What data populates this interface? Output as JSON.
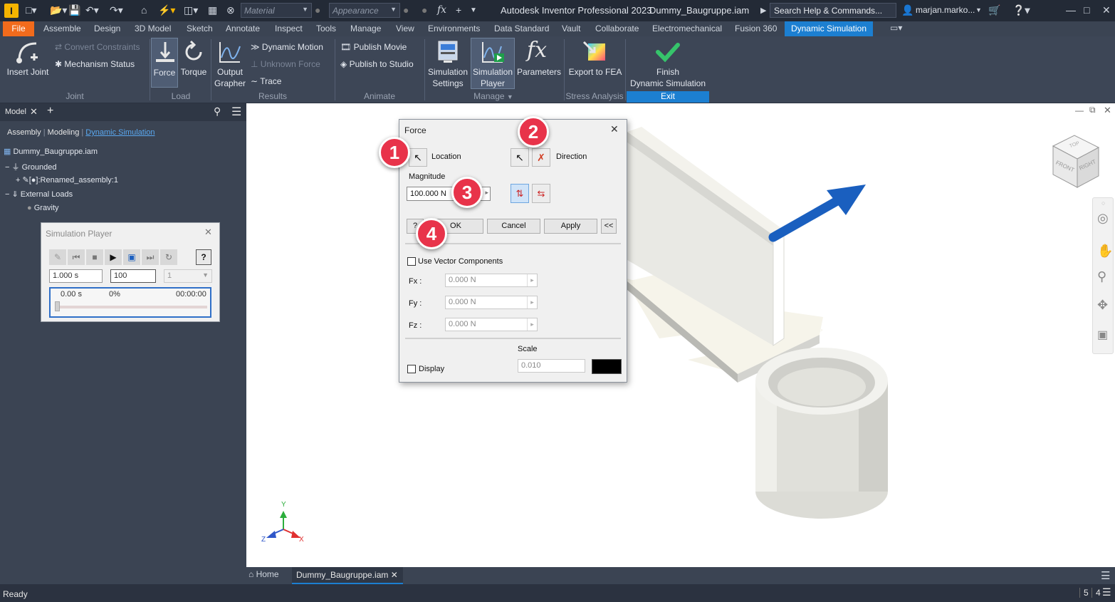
{
  "app": {
    "title": "Autodesk Inventor Professional 2023",
    "document": "Dummy_Baugruppe.iam",
    "search_placeholder": "Search Help & Commands...",
    "user": "marjan.marko...",
    "material_placeholder": "Material",
    "appearance_placeholder": "Appearance"
  },
  "menu_tabs": [
    "File",
    "Assemble",
    "Design",
    "3D Model",
    "Sketch",
    "Annotate",
    "Inspect",
    "Tools",
    "Manage",
    "View",
    "Environments",
    "Data Standard",
    "Vault",
    "Collaborate",
    "Electromechanical",
    "Fusion 360",
    "Dynamic Simulation"
  ],
  "ribbon": {
    "joint": {
      "insert_joint": "Insert Joint",
      "convert_constraints": "Convert Constraints",
      "mechanism_status": "Mechanism Status",
      "group": "Joint"
    },
    "load": {
      "force": "Force",
      "torque": "Torque",
      "group": "Load"
    },
    "results": {
      "output_grapher_1": "Output",
      "output_grapher_2": "Grapher",
      "dynamic_motion": "Dynamic Motion",
      "unknown_force": "Unknown Force",
      "trace": "Trace",
      "group": "Results"
    },
    "animate": {
      "publish_movie": "Publish Movie",
      "publish_studio": "Publish to Studio",
      "group": "Animate"
    },
    "manage": {
      "sim_settings_1": "Simulation",
      "sim_settings_2": "Settings",
      "sim_player_1": "Simulation",
      "sim_player_2": "Player",
      "parameters": "Parameters",
      "group": "Manage"
    },
    "stress": {
      "export_fea": "Export to FEA",
      "group": "Stress Analysis"
    },
    "exit": {
      "finish_1": "Finish",
      "finish_2": "Dynamic Simulation",
      "group": "Exit"
    }
  },
  "browser": {
    "tab_label": "Model",
    "modes": [
      "Assembly",
      "Modeling",
      "Dynamic Simulation"
    ],
    "tree": {
      "root": "Dummy_Baugruppe.iam",
      "grounded": "Grounded",
      "renamed": "[●]:Renamed_assembly:1",
      "external_loads": "External Loads",
      "gravity": "Gravity"
    }
  },
  "sim_player": {
    "title": "Simulation Player",
    "end_time": "1.000 s",
    "images": "100",
    "filter": "1",
    "current_time": "0.00 s",
    "percent": "0%",
    "elapsed": "00:00:00"
  },
  "force_dialog": {
    "title": "Force",
    "location": "Location",
    "direction": "Direction",
    "magnitude_label": "Magnitude",
    "magnitude_value": "100.000 N",
    "ok": "OK",
    "cancel": "Cancel",
    "apply": "Apply",
    "more": "<<",
    "use_vector": "Use Vector Components",
    "fx_label": "Fx :",
    "fy_label": "Fy :",
    "fz_label": "Fz :",
    "fx": "0.000 N",
    "fy": "0.000 N",
    "fz": "0.000 N",
    "scale_label": "Scale",
    "scale_value": "0.010",
    "display": "Display",
    "display_color": "#000000"
  },
  "callouts": [
    "1",
    "2",
    "3",
    "4"
  ],
  "doc_tabs": {
    "home": "Home",
    "document": "Dummy_Baugruppe.iam"
  },
  "status": {
    "text": "Ready",
    "count1": "5",
    "count2": "4"
  },
  "viewcube": {
    "top": "TOP",
    "front": "FRONT",
    "right": "RIGHT"
  },
  "triad": {
    "x": "X",
    "y": "Y",
    "z": "Z"
  },
  "colors": {
    "accent": "#1c7fd1",
    "file_tab": "#f26b1c",
    "callout": "#e8334a",
    "arrow": "#1a5fbf"
  }
}
